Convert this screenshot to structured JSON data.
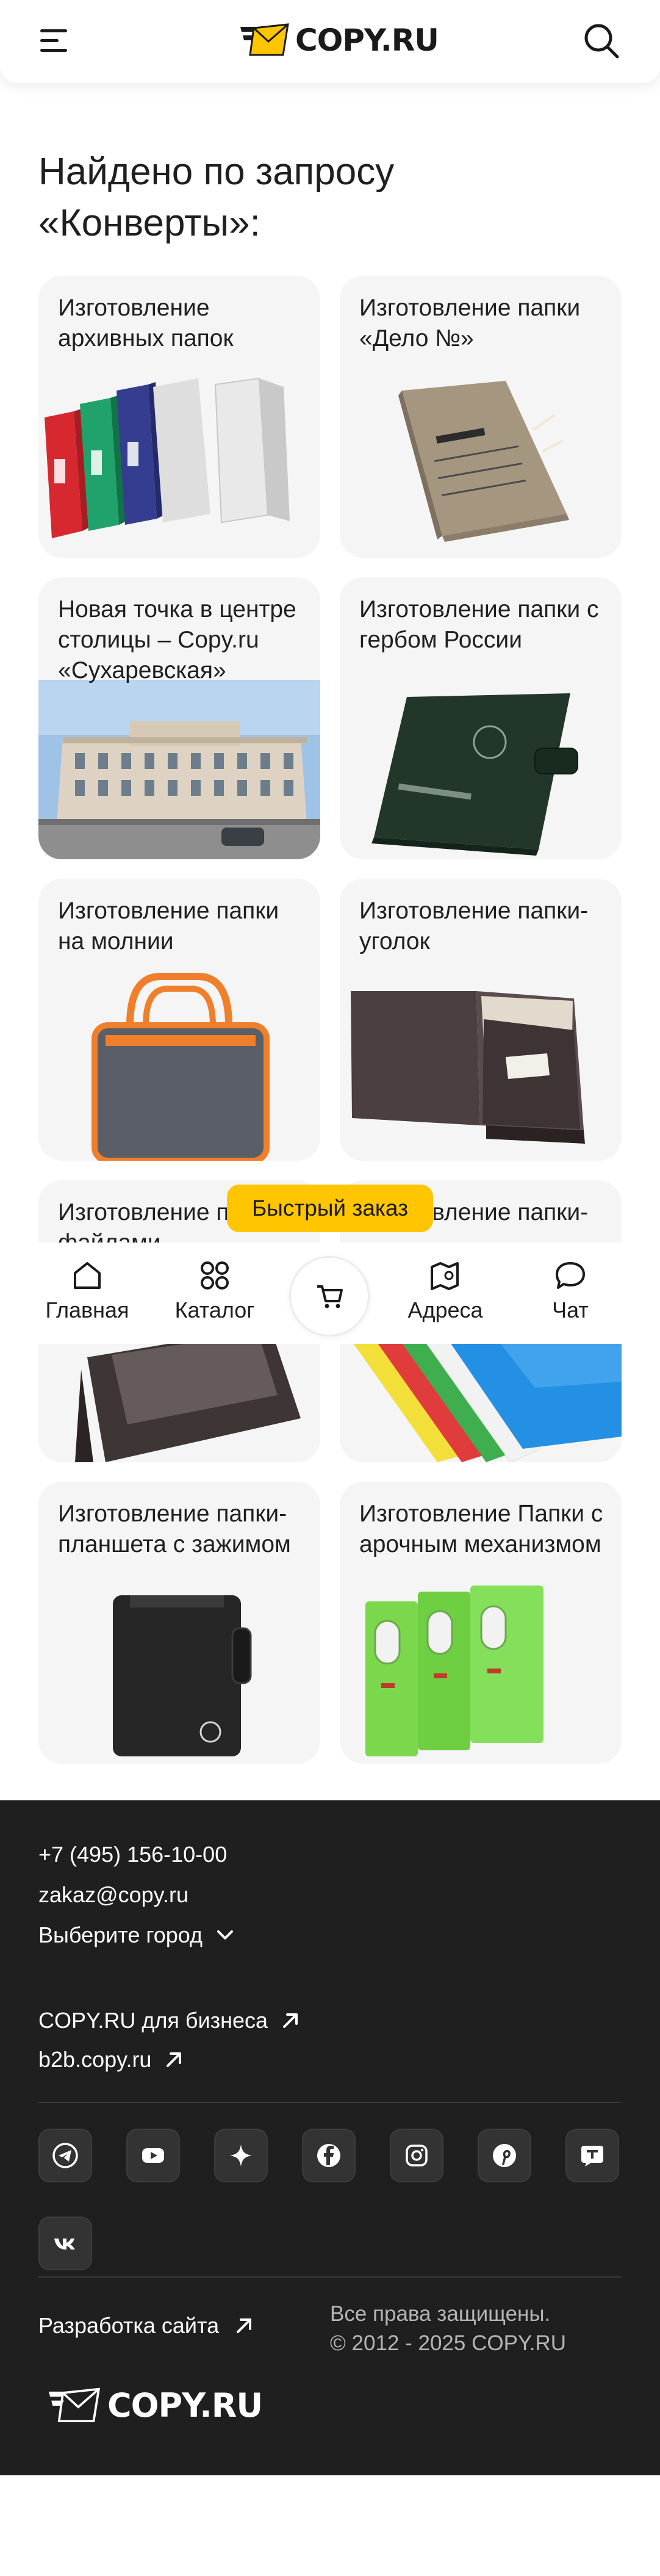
{
  "header": {
    "logo_text": "COPY.RU"
  },
  "page_title": "Найдено по запросу «Конверты»:",
  "cards": [
    {
      "title": "Изготовление архивных папок"
    },
    {
      "title": "Изготовление папки «Дело №»"
    },
    {
      "title": "Новая точка в центре столицы – Copy.ru «Сухаревская»"
    },
    {
      "title": "Изготовление папки с гербом России"
    },
    {
      "title": "Изготовление папки на молнии"
    },
    {
      "title": "Изготовление папки-уголок"
    },
    {
      "title": "Изготовление папки с файлами"
    },
    {
      "title": "Изготовление папки-"
    },
    {
      "title": "Изготовление папки-планшета с зажимом"
    },
    {
      "title": "Изготовление Папки с арочным механизмом"
    }
  ],
  "fast_order": "Быстрый заказ",
  "bottom_nav": {
    "home": "Главная",
    "catalog": "Каталог",
    "addresses": "Адреса",
    "chat": "Чат"
  },
  "footer": {
    "phone": "+7 (495) 156-10-00",
    "email": "zakaz@copy.ru",
    "city": "Выберите город",
    "business": "COPY.RU для бизнеса",
    "b2b": "b2b.copy.ru",
    "rights_line1": "Все права защищены.",
    "rights_line2": "© 2012 - 2025 COPY.RU",
    "dev": "Разработка сайта",
    "logo_text": "COPY.RU",
    "socials": [
      "telegram-icon",
      "youtube-icon",
      "sparkle-icon",
      "facebook-icon",
      "instagram-icon",
      "pinterest-icon",
      "tenchat-icon",
      "vk-icon"
    ]
  },
  "colors": {
    "accent": "#ffc600",
    "footer_bg": "#1f1f1f",
    "card_bg": "#f5f5f5"
  }
}
